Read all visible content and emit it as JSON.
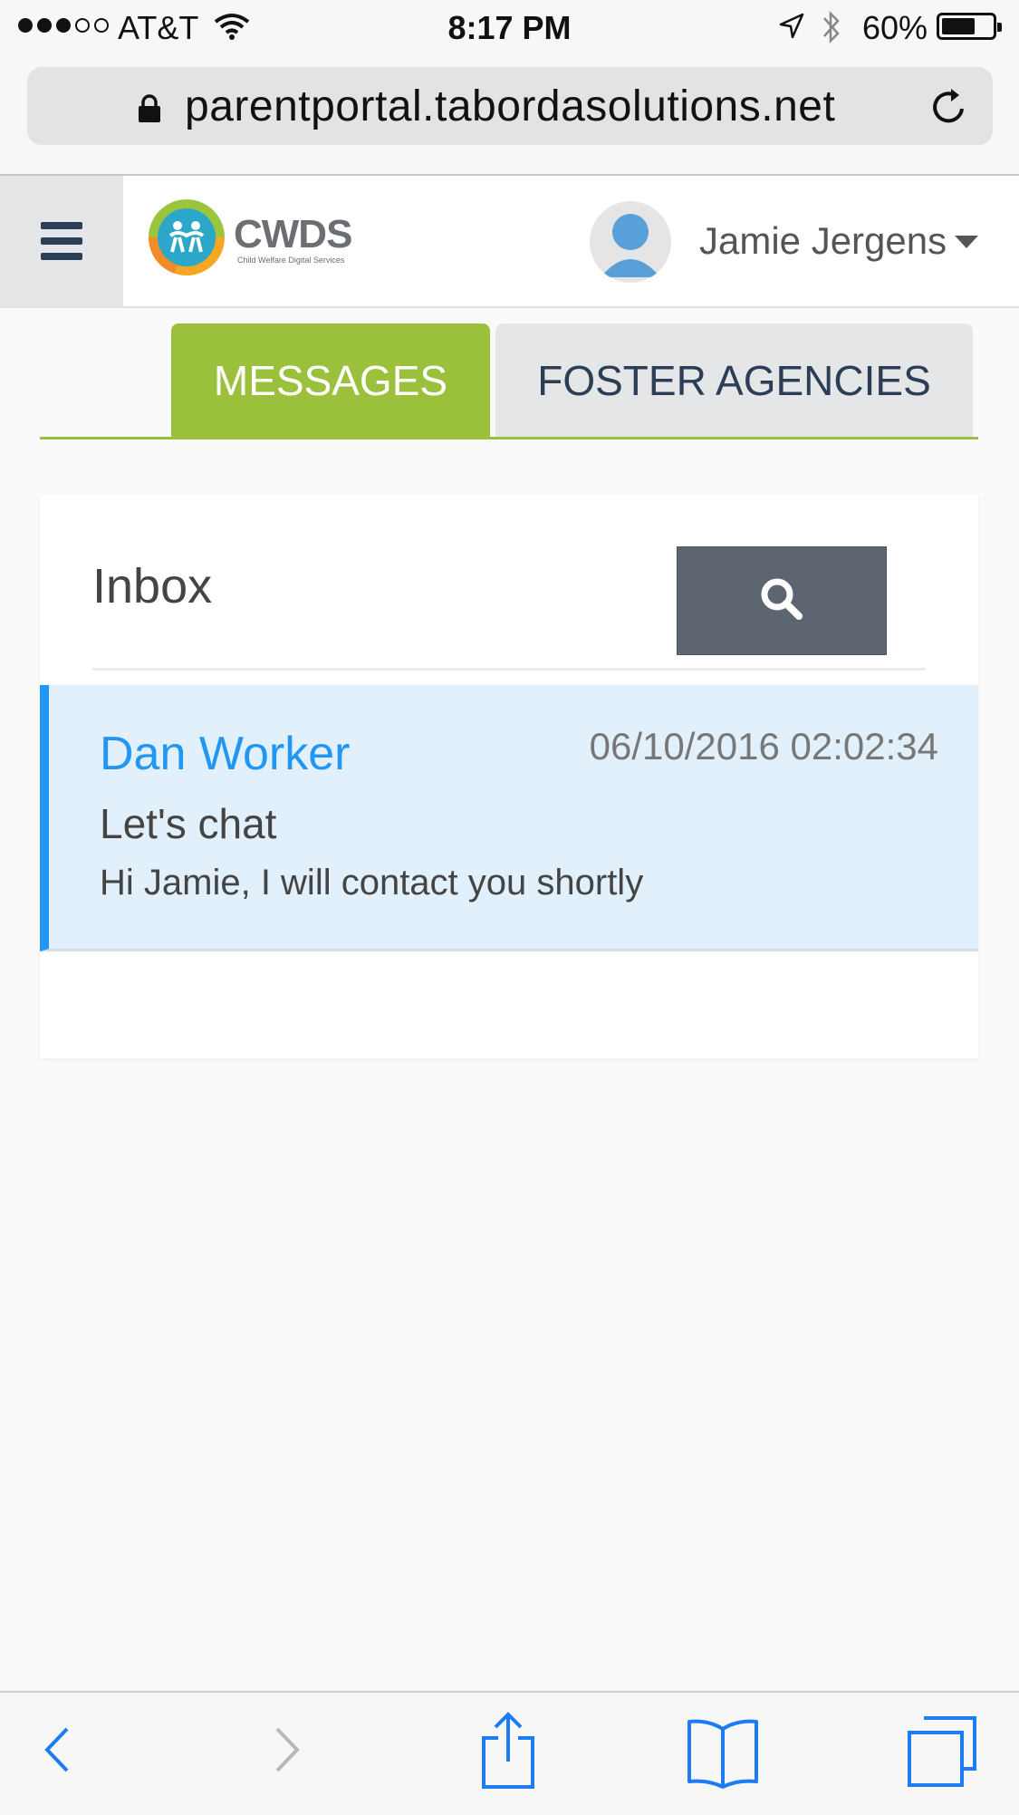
{
  "status_bar": {
    "carrier": "AT&T",
    "time": "8:17 PM",
    "battery_percent": "60%",
    "battery_level": 0.6,
    "signal_bars": 3,
    "signal_total": 5
  },
  "browser": {
    "url": "parentportal.tabordasolutions.net"
  },
  "header": {
    "logo_text": "CWDS",
    "logo_tagline": "Child Welfare Digital Services",
    "user_name": "Jamie Jergens"
  },
  "tabs": [
    {
      "label": "MESSAGES",
      "active": true
    },
    {
      "label": "FOSTER AGENCIES",
      "active": false
    }
  ],
  "inbox": {
    "title": "Inbox",
    "messages": [
      {
        "from": "Dan Worker",
        "timestamp": "06/10/2016 02:02:34",
        "subject": "Let's chat",
        "preview": "Hi Jamie, I will contact you shortly"
      }
    ]
  },
  "colors": {
    "accent_green": "#9bc13c",
    "link_blue": "#2196f3",
    "navy": "#2c3e55",
    "search_button": "#5d6570",
    "selected_row": "#e2f0fc"
  },
  "icons": {
    "menu": "hamburger-icon",
    "search": "search-icon",
    "user": "user-avatar-icon",
    "caret": "caret-down-icon",
    "lock": "lock-icon",
    "reload": "reload-icon",
    "back": "back-arrow-icon",
    "forward": "forward-arrow-icon",
    "share": "share-icon",
    "bookmarks": "bookmarks-icon",
    "tabs": "tabs-icon"
  }
}
